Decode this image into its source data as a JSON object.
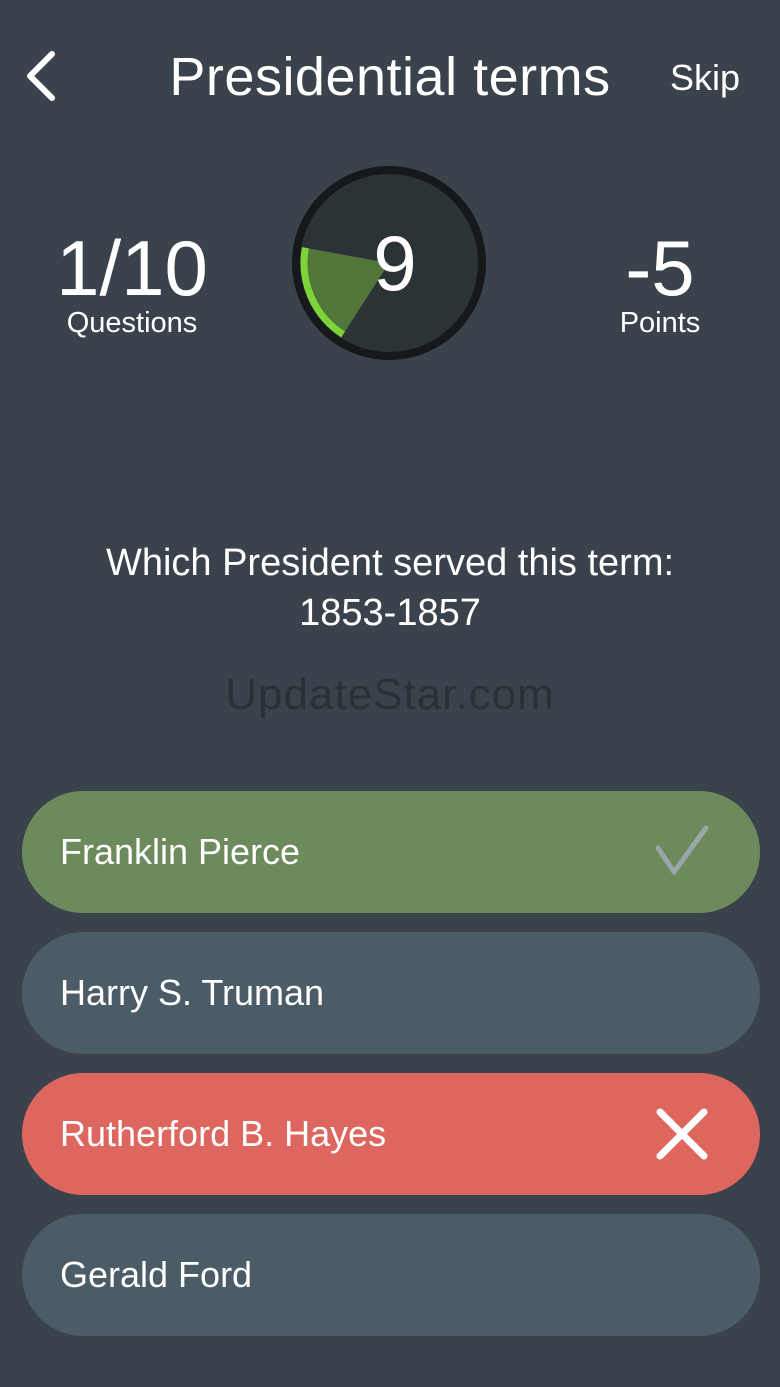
{
  "header": {
    "title": "Presidential terms",
    "skip_label": "Skip"
  },
  "stats": {
    "questions_value": "1/10",
    "questions_label": "Questions",
    "points_value": "-5",
    "points_label": "Points"
  },
  "timer": {
    "seconds": "9",
    "elapsed_fraction": 0.13
  },
  "question": {
    "line1": "Which President served this term:",
    "line2": "1853-1857"
  },
  "watermark": "UpdateStar.com",
  "answers": [
    {
      "label": "Franklin Pierce",
      "state": "correct",
      "icon": "checkmark-icon"
    },
    {
      "label": "Harry S. Truman",
      "state": "neutral",
      "icon": ""
    },
    {
      "label": "Rutherford B. Hayes",
      "state": "wrong",
      "icon": "close-icon"
    },
    {
      "label": "Gerald Ford",
      "state": "neutral",
      "icon": ""
    }
  ],
  "colors": {
    "background": "#3a434b",
    "correct": "#6c8a5c",
    "neutral": "#4b5c67",
    "wrong": "#dd665f",
    "timer_face": "#2c3337",
    "timer_ring": "#15191b",
    "timer_arc": "#7cd438"
  }
}
